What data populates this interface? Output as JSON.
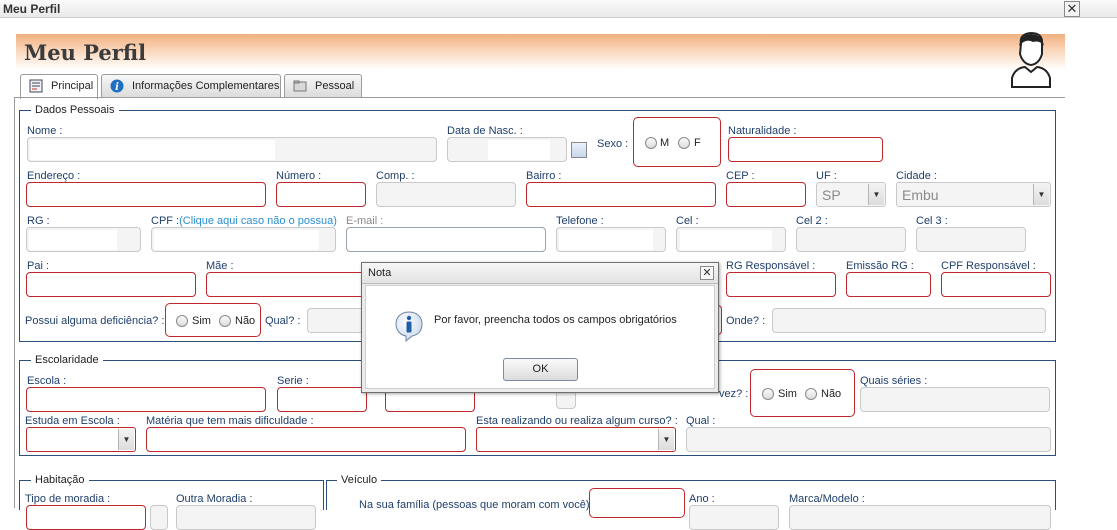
{
  "window": {
    "title": "Meu Perfil",
    "close": "✕"
  },
  "header": {
    "title": "Meu Perfil"
  },
  "tabs": [
    {
      "label": "Principal",
      "icon": "form-icon"
    },
    {
      "label": "Informações Complementares",
      "icon": "info-icon"
    },
    {
      "label": "Pessoal",
      "icon": "folder-icon"
    }
  ],
  "dados_pessoais": {
    "legend": "Dados Pessoais",
    "nome": "Nome :",
    "data_nasc": "Data de Nasc. :",
    "sexo": "Sexo :",
    "sexo_m": "M",
    "sexo_f": "F",
    "naturalidade": "Naturalidade :",
    "endereco": "Endereço :",
    "numero": "Número :",
    "comp": "Comp. :",
    "bairro": "Bairro :",
    "cep": "CEP :",
    "uf": "UF :",
    "uf_value": "SP",
    "cidade": "Cidade :",
    "cidade_value": "Embu",
    "rg": "RG :",
    "cpf": "CPF :",
    "cpf_link": "(Clique aqui caso não o possua)",
    "email": "E-mail :",
    "telefone": "Telefone :",
    "cel": "Cel :",
    "cel2": "Cel 2 :",
    "cel3": "Cel 3 :",
    "pai": "Pai :",
    "mae": "Mãe :",
    "rg_resp": "RG Responsável :",
    "emissao_rg": "Emissão RG :",
    "cpf_resp": "CPF Responsável :",
    "deficiencia": "Possui alguma deficiência? :",
    "sim": "Sim",
    "nao": "Não",
    "qual": "Qual? :",
    "onde": "Onde? :"
  },
  "escolaridade": {
    "legend": "Escolaridade",
    "escola": "Escola :",
    "serie": "Serie :",
    "vez": "vez? :",
    "sim": "Sim",
    "nao": "Não",
    "quais_series": "Quais séries :",
    "estuda_em": "Estuda em Escola :",
    "materia": "Matéria que tem mais dificuldade :",
    "curso": "Esta realizando ou realiza algum curso? :",
    "qual": "Qual :"
  },
  "habitacao": {
    "legend": "Habitação",
    "tipo": "Tipo de moradia :",
    "outra": "Outra Moradia :"
  },
  "veiculo": {
    "legend": "Veículo",
    "familia": "Na sua família (pessoas que moram com você)",
    "ano": "Ano :",
    "marca": "Marca/Modelo :"
  },
  "dialog": {
    "title": "Nota",
    "close": "✕",
    "message": "Por favor, preencha todos os campos obrigatórios",
    "ok": "OK"
  },
  "colors": {
    "required_border": "#c0272d",
    "label": "#1f3f6b",
    "link": "#2a8fd0"
  }
}
